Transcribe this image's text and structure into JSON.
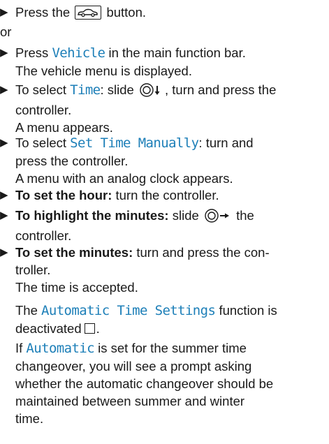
{
  "steps": [
    {
      "pre": "Press the",
      "post": "button.",
      "icon": "car-icon"
    },
    {
      "or": "or"
    },
    {
      "pre": "Press",
      "kw": "Vehicle",
      "post": "in the main function bar.",
      "result": "The vehicle menu is displayed."
    },
    {
      "pre": "To select",
      "kw": "Time",
      "mid": ": slide",
      "post_line1": ", turn and press the",
      "post_line2": "controller.",
      "result": "A menu appears.",
      "icon": "controller-slide-down-icon"
    },
    {
      "pre": "To select",
      "kw": "Set Time Manually",
      "mid": ": turn and",
      "line2": "press the controller.",
      "result": "A menu with an analog clock appears."
    },
    {
      "bold": "To set the hour:",
      "post": "turn the controller."
    },
    {
      "bold": "To highlight the minutes:",
      "mid": "slide",
      "post": "the",
      "line2": "controller.",
      "icon": "controller-slide-right-icon"
    },
    {
      "bold": "To set the minutes:",
      "post": "turn and press the con-",
      "line2": "troller.",
      "result": "The time is accepted."
    }
  ],
  "note1": {
    "pre": "The",
    "kw": "Automatic Time Settings",
    "post": "function is",
    "line2": "deactivated",
    "icon": "unchecked-checkbox-icon"
  },
  "note2": {
    "pre": "If",
    "kw": "Automatic",
    "post": "is set for the summer time",
    "line2": "changeover, you will see a prompt asking",
    "line3": "whether the automatic changeover should be",
    "line4": "maintained between summer and winter",
    "line5": "time."
  }
}
